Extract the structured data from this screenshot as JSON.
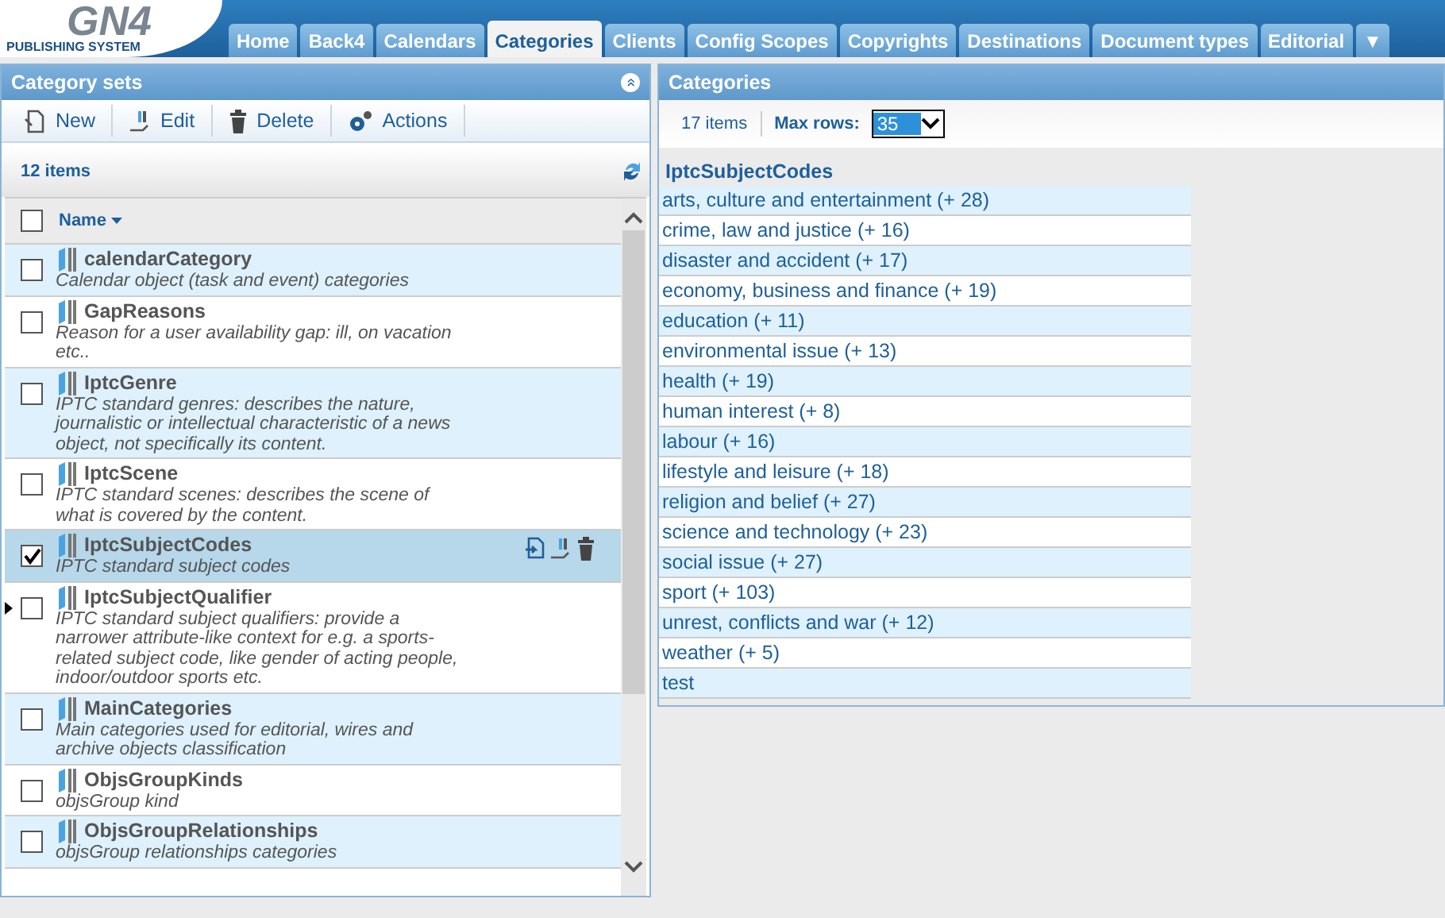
{
  "logo": {
    "mark": "GN4",
    "subtitle": "PUBLISHING SYSTEM"
  },
  "tabs": [
    {
      "label": "Home",
      "selected": false
    },
    {
      "label": "Back4",
      "selected": false
    },
    {
      "label": "Calendars",
      "selected": false
    },
    {
      "label": "Categories",
      "selected": true
    },
    {
      "label": "Clients",
      "selected": false
    },
    {
      "label": "Config Scopes",
      "selected": false
    },
    {
      "label": "Copyrights",
      "selected": false
    },
    {
      "label": "Destinations",
      "selected": false
    },
    {
      "label": "Document types",
      "selected": false
    },
    {
      "label": "Editorial",
      "selected": false
    }
  ],
  "tabs_more": "▼",
  "left_panel": {
    "title": "Category sets",
    "collapse": "»",
    "toolbar": [
      {
        "kind": "new",
        "label": "New"
      },
      {
        "kind": "edit",
        "label": "Edit"
      },
      {
        "kind": "delete",
        "label": "Delete"
      },
      {
        "kind": "actions",
        "label": "Actions"
      }
    ],
    "count": "12 items",
    "column": "Name",
    "select_all": false,
    "rows": [
      {
        "name": "calendarCategory",
        "description": "Calendar object (task and event) categories",
        "checked": false,
        "selected": false,
        "current": false
      },
      {
        "name": "GapReasons",
        "description": "Reason for a user availability gap: ill, on vacation etc..",
        "checked": false,
        "selected": false,
        "current": false
      },
      {
        "name": "IptcGenre",
        "description": "IPTC standard genres: describes the nature, journalistic or intellectual characteristic of a news object, not specifically its content.",
        "checked": false,
        "selected": false,
        "current": false
      },
      {
        "name": "IptcScene",
        "description": "IPTC standard scenes: describes the scene of what is covered by the content.",
        "checked": false,
        "selected": false,
        "current": false
      },
      {
        "name": "IptcSubjectCodes",
        "description": "IPTC standard subject codes",
        "checked": true,
        "selected": true,
        "current": false
      },
      {
        "name": "IptcSubjectQualifier",
        "description": "IPTC standard subject qualifiers: provide a narrower attribute-like context for e.g. a sports-related subject code, like gender of acting people, indoor/outdoor sports etc.",
        "checked": false,
        "selected": false,
        "current": true
      },
      {
        "name": "MainCategories",
        "description": "Main categories used for editorial, wires and archive objects classification",
        "checked": false,
        "selected": false,
        "current": false
      },
      {
        "name": "ObjsGroupKinds",
        "description": "objsGroup kind",
        "checked": false,
        "selected": false,
        "current": false
      },
      {
        "name": "ObjsGroupRelationships",
        "description": "objsGroup relationships categories",
        "checked": false,
        "selected": false,
        "current": false
      }
    ]
  },
  "right_panel": {
    "title": "Categories",
    "count": "17 items",
    "max_rows_label": "Max rows:",
    "max_rows": "35",
    "set_name": "IptcSubjectCodes",
    "items": [
      "arts, culture and entertainment (+ 28)",
      "crime, law and justice (+ 16)",
      "disaster and accident (+ 17)",
      "economy, business and finance (+ 19)",
      "education (+ 11)",
      "environmental issue (+ 13)",
      "health (+ 19)",
      "human interest (+ 8)",
      "labour (+ 16)",
      "lifestyle and leisure (+ 18)",
      "religion and belief (+ 27)",
      "science and technology (+ 23)",
      "social issue (+ 27)",
      "sport (+ 103)",
      "unrest, conflicts and war (+ 12)",
      "weather (+ 5)",
      "test"
    ]
  }
}
